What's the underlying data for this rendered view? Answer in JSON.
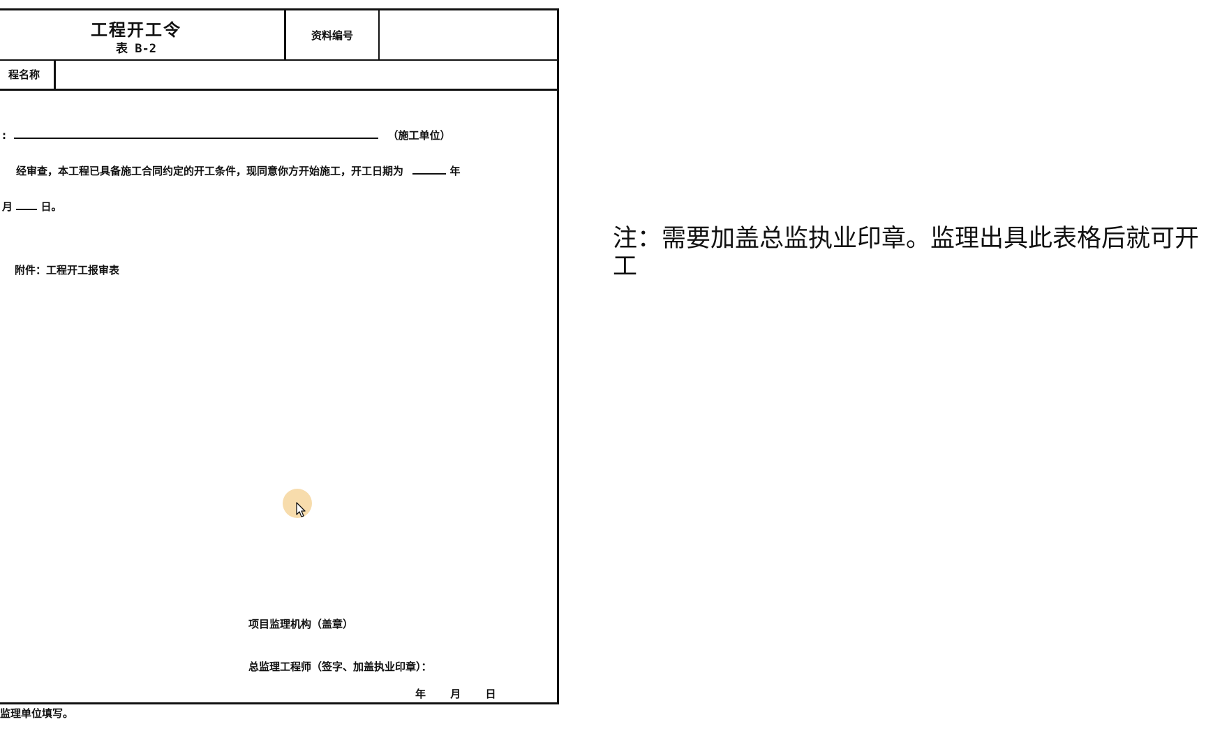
{
  "form": {
    "title": "工程开工令",
    "subtitle": "表 B-2",
    "code_label": "资料编号",
    "code_value": "",
    "project_name_label": "程名称",
    "project_name_value": "",
    "addressee_prefix": ":",
    "addressee_suffix": "（施工单位）",
    "body_line1": "经审查，本工程已具备施工合同约定的开工条件，现同意你方开始施工，开工日期为",
    "year_char": "年",
    "month_char": "月",
    "day_char": "日。",
    "attachment": "附件：工程开工报审表",
    "org_label": "项目监理机构（盖章）",
    "engineer_label": "总监理工程师（签字、加盖执业印章）：",
    "date_year": "年",
    "date_month": "月",
    "date_day": "日",
    "footnote": "监理单位填写。"
  },
  "note": {
    "text": "注：需要加盖总监执业印章。监理出具此表格后就可开工"
  },
  "colors": {
    "border": "#111111",
    "cursor_halo": "#f6d69e"
  }
}
